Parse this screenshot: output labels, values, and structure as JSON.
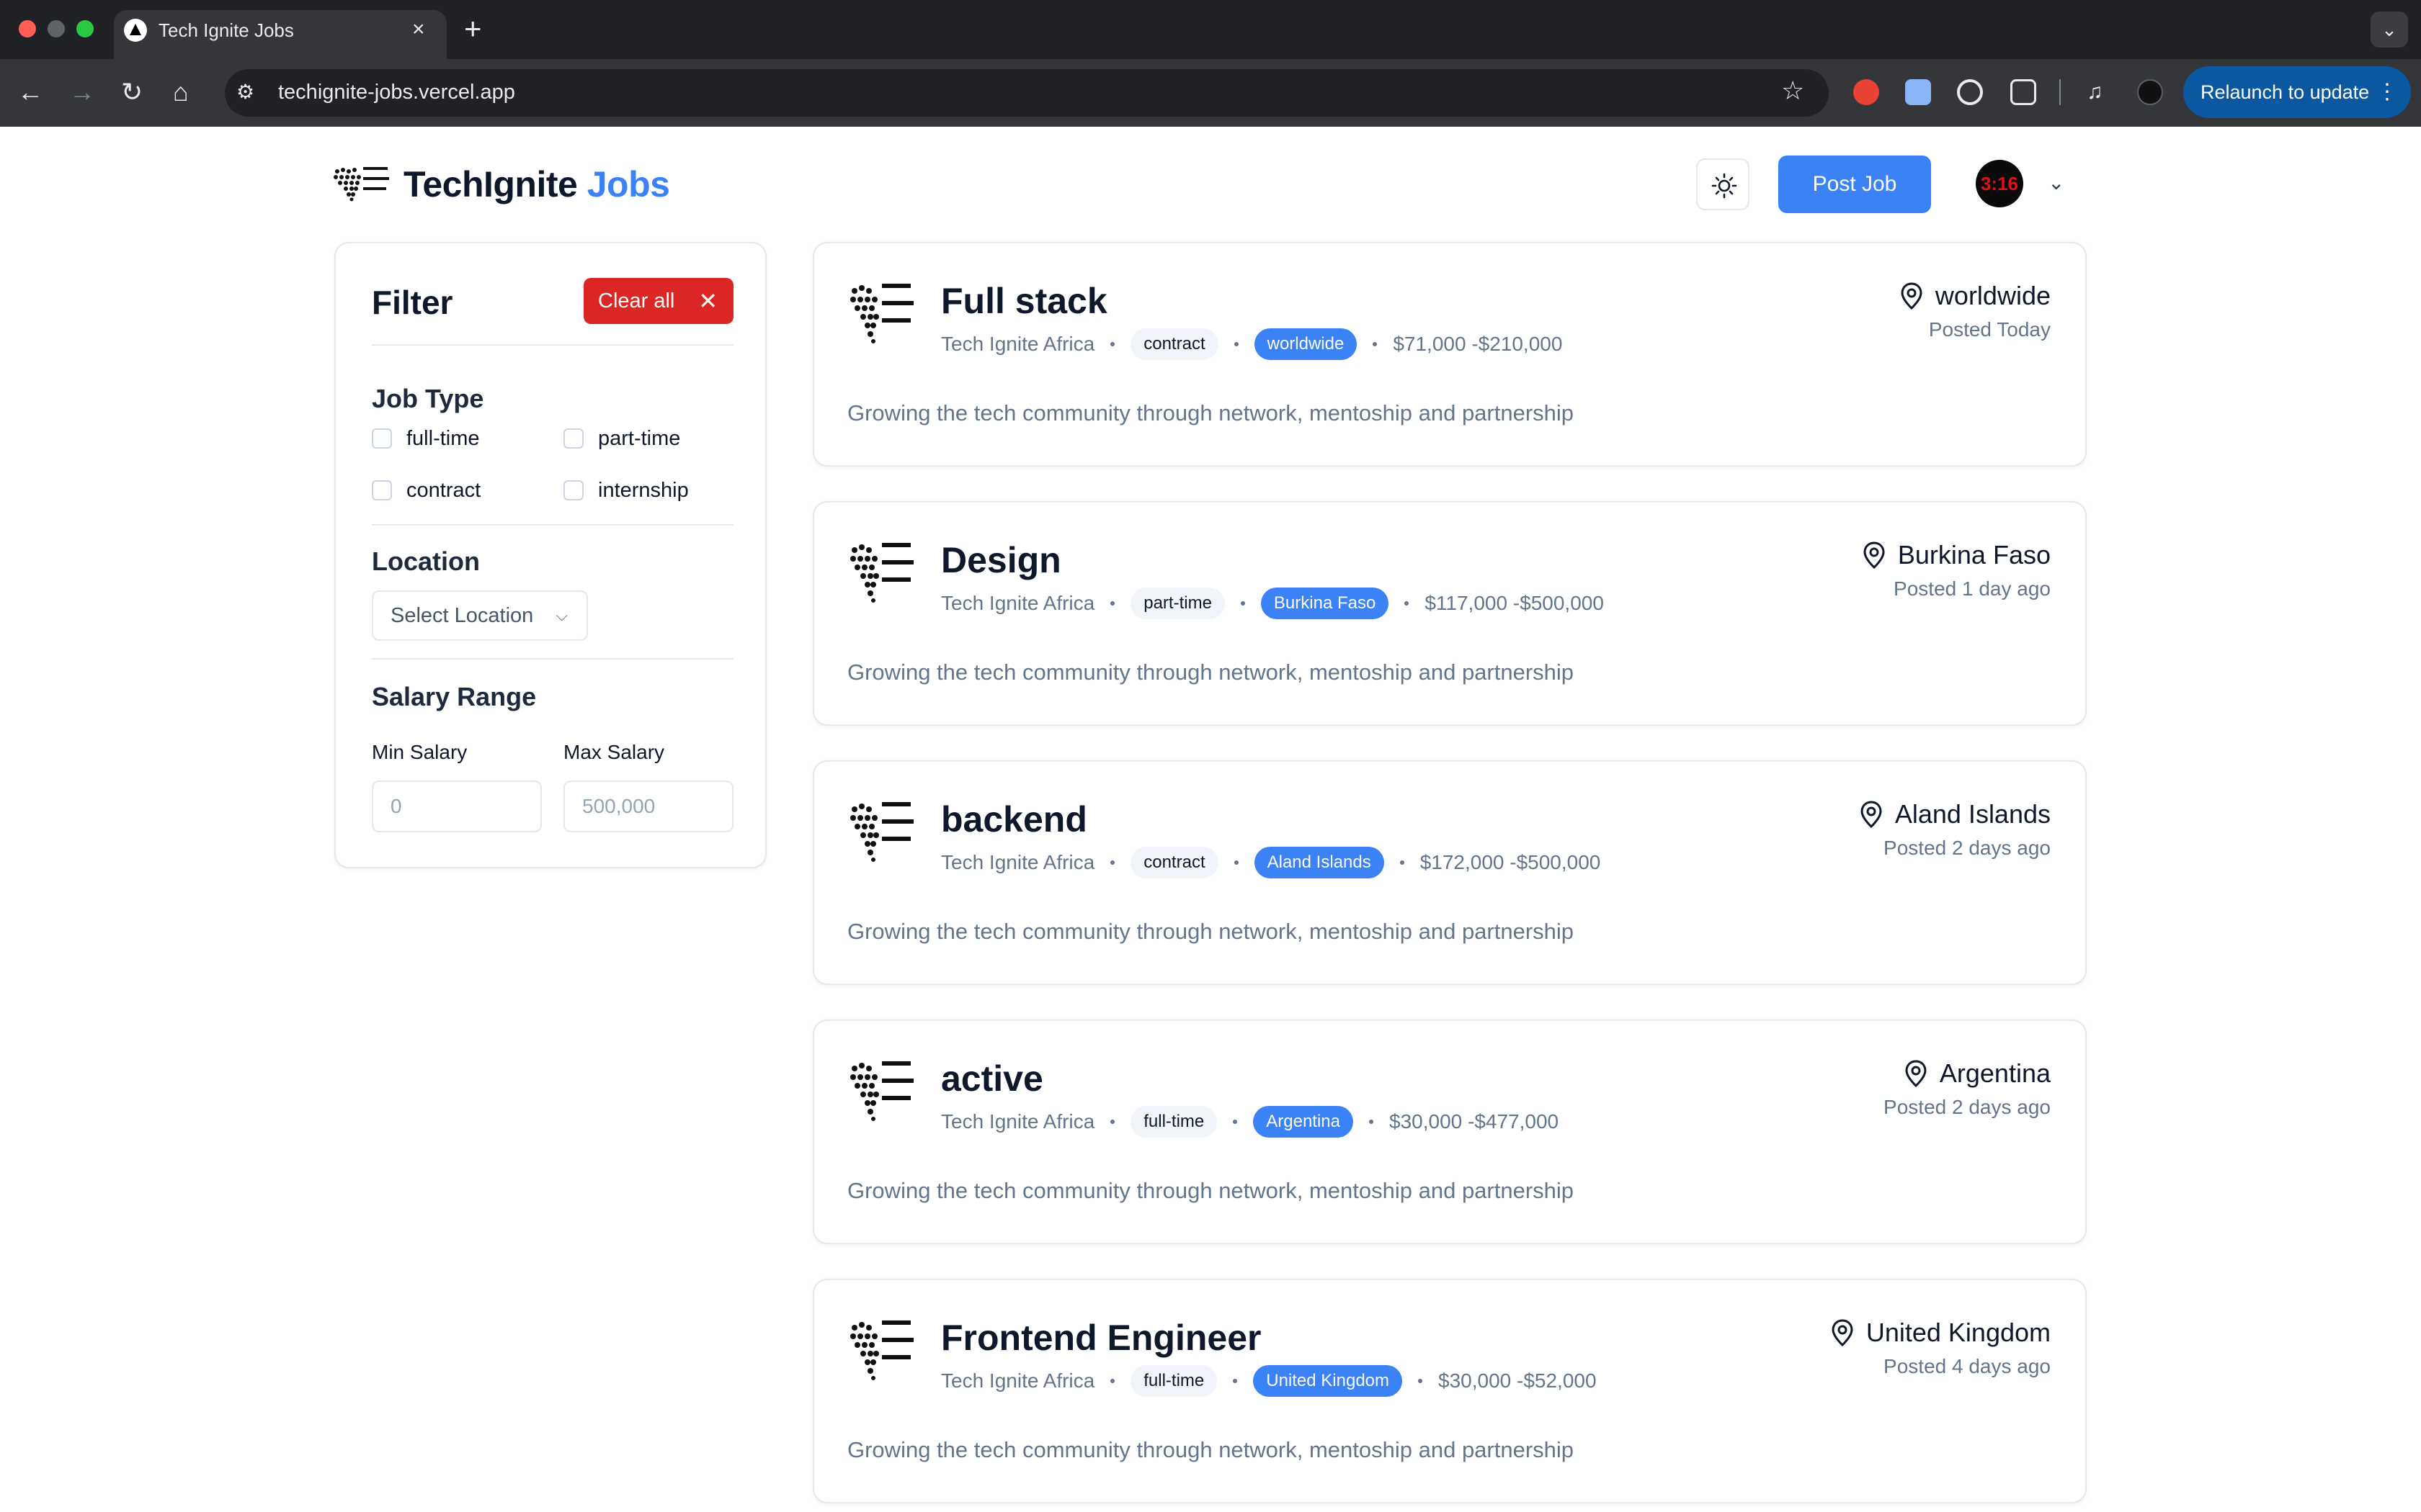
{
  "browser": {
    "tab_title": "Tech Ignite Jobs",
    "url": "techignite-jobs.vercel.app",
    "relaunch_label": "Relaunch to update",
    "avatar_text": "3:16"
  },
  "header": {
    "brand_primary": "TechIgnite",
    "brand_accent": "Jobs",
    "post_job_label": "Post Job",
    "avatar_text": "3:16"
  },
  "filter": {
    "title": "Filter",
    "clear_label": "Clear all",
    "job_type_heading": "Job Type",
    "job_types": [
      "full-time",
      "part-time",
      "contract",
      "internship"
    ],
    "location_heading": "Location",
    "location_placeholder": "Select Location",
    "salary_heading": "Salary Range",
    "min_label": "Min Salary",
    "max_label": "Max Salary",
    "min_placeholder": "0",
    "max_placeholder": "500,000"
  },
  "jobs": [
    {
      "title": "Full stack",
      "company": "Tech Ignite Africa",
      "type": "contract",
      "location": "worldwide",
      "salary": "$71,000 -$210,000",
      "posted": "Posted Today",
      "description": "Growing the tech community through network, mentoship and partnership"
    },
    {
      "title": "Design",
      "company": "Tech Ignite Africa",
      "type": "part-time",
      "location": "Burkina Faso",
      "salary": "$117,000 -$500,000",
      "posted": "Posted 1 day ago",
      "description": "Growing the tech community through network, mentoship and partnership"
    },
    {
      "title": "backend",
      "company": "Tech Ignite Africa",
      "type": "contract",
      "location": "Aland Islands",
      "salary": "$172,000 -$500,000",
      "posted": "Posted 2 days ago",
      "description": "Growing the tech community through network, mentoship and partnership"
    },
    {
      "title": "active",
      "company": "Tech Ignite Africa",
      "type": "full-time",
      "location": "Argentina",
      "salary": "$30,000 -$477,000",
      "posted": "Posted 2 days ago",
      "description": "Growing the tech community through network, mentoship and partnership"
    },
    {
      "title": "Frontend Engineer",
      "company": "Tech Ignite Africa",
      "type": "full-time",
      "location": "United Kingdom",
      "salary": "$30,000 -$52,000",
      "posted": "Posted 4 days ago",
      "description": "Growing the tech community through network, mentoship and partnership"
    }
  ],
  "colors": {
    "accent": "#3b82f6",
    "danger": "#dc2626",
    "muted_text": "#64748b"
  }
}
